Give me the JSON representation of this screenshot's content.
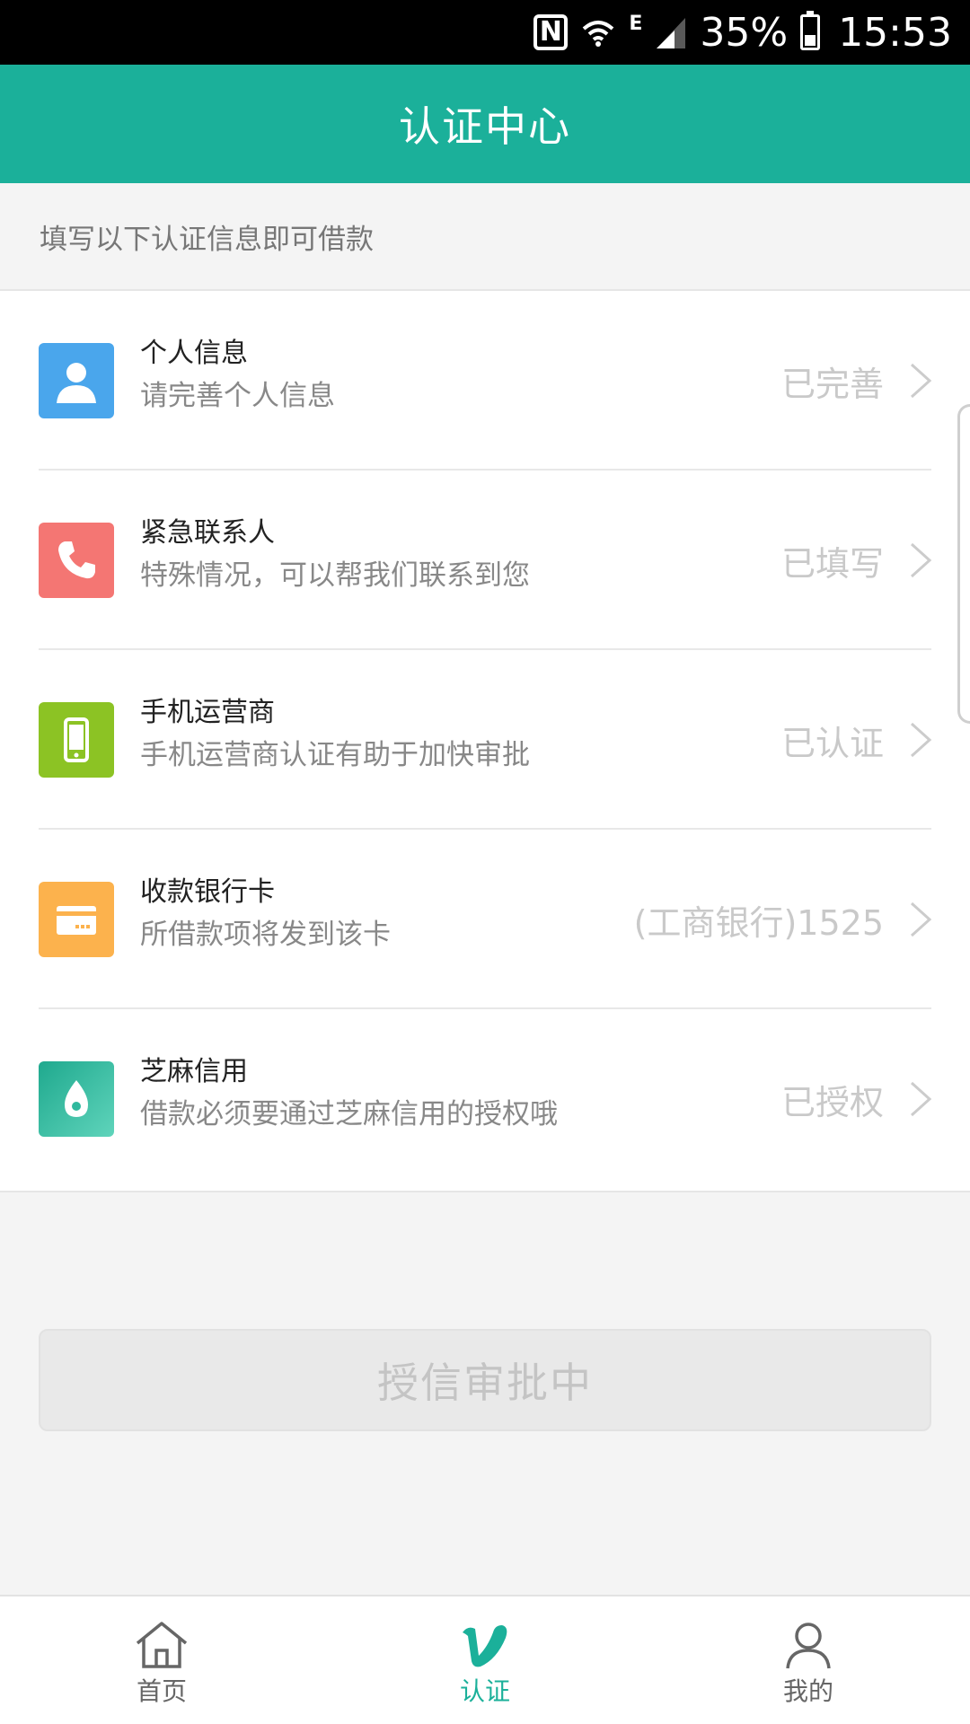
{
  "status_bar": {
    "network_type": "E",
    "battery_percent": "35%",
    "battery_level": 0.35,
    "time": "15:53",
    "icons": [
      "nfc-icon",
      "wifi-icon",
      "signal-icon",
      "battery-icon"
    ]
  },
  "header": {
    "title": "认证中心"
  },
  "hint": "填写以下认证信息即可借款",
  "items": [
    {
      "title": "个人信息",
      "subtitle": "请完善个人信息",
      "status": "已完善",
      "icon": "person-icon",
      "color": "#4aa6ec"
    },
    {
      "title": "紧急联系人",
      "subtitle": "特殊情况，可以帮我们联系到您",
      "status": "已填写",
      "icon": "phone-icon",
      "color": "#f47673"
    },
    {
      "title": "手机运营商",
      "subtitle": "手机运营商认证有助于加快审批",
      "status": "已认证",
      "icon": "mobile-icon",
      "color": "#8cc324"
    },
    {
      "title": "收款银行卡",
      "subtitle": "所借款项将发到该卡",
      "status": "(工商银行)1525",
      "icon": "bank-card-icon",
      "color": "#fcb24d"
    },
    {
      "title": "芝麻信用",
      "subtitle": "借款必须要通过芝麻信用的授权哦",
      "status": "已授权",
      "icon": "sesame-credit-icon",
      "color": "#2fb99e"
    }
  ],
  "approval_button": "授信审批中",
  "bottom_nav": [
    {
      "label": "首页",
      "icon": "home-icon",
      "active": false
    },
    {
      "label": "认证",
      "icon": "verify-icon",
      "active": true
    },
    {
      "label": "我的",
      "icon": "profile-icon",
      "active": false
    }
  ],
  "colors": {
    "primary": "#1bb09a",
    "background": "#f4f4f4",
    "status_text": "#c9c9c9"
  }
}
